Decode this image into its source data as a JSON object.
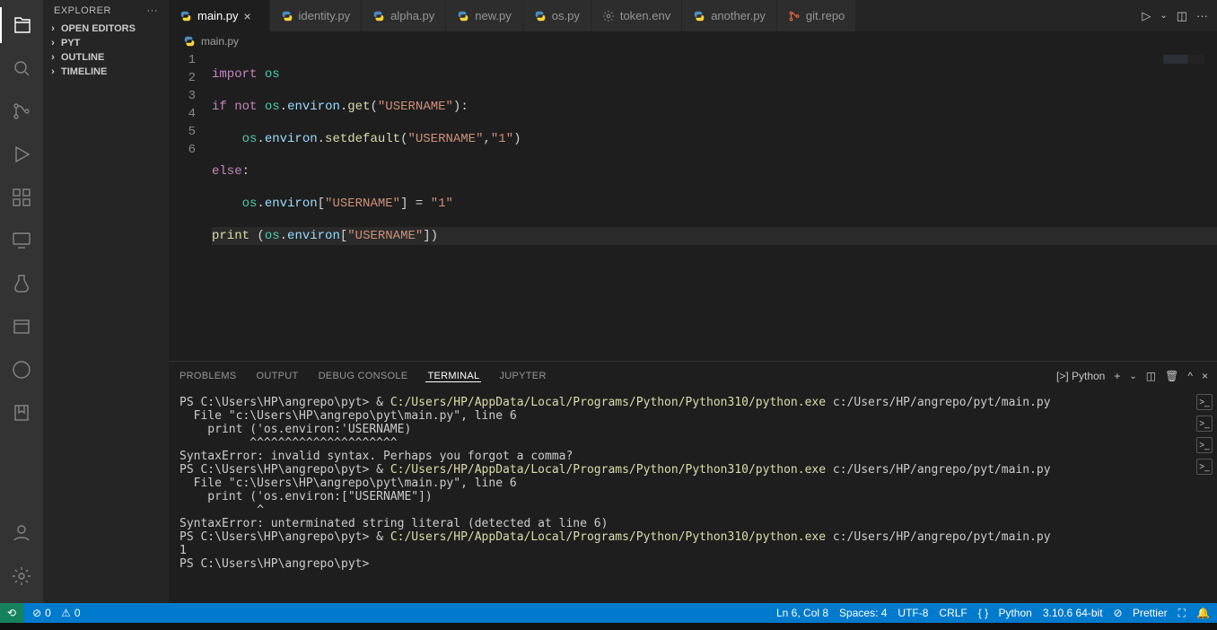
{
  "sidebar": {
    "title": "EXPLORER",
    "sections": [
      "OPEN EDITORS",
      "PYT",
      "OUTLINE",
      "TIMELINE"
    ]
  },
  "tabs": [
    {
      "label": "main.py",
      "icon": "python",
      "active": true
    },
    {
      "label": "identity.py",
      "icon": "python"
    },
    {
      "label": "alpha.py",
      "icon": "python"
    },
    {
      "label": "new.py",
      "icon": "python"
    },
    {
      "label": "os.py",
      "icon": "python"
    },
    {
      "label": "token.env",
      "icon": "gear"
    },
    {
      "label": "another.py",
      "icon": "python"
    },
    {
      "label": "git.repo",
      "icon": "git"
    }
  ],
  "breadcrumb": {
    "file": "main.py"
  },
  "editor": {
    "line_numbers": [
      "1",
      "2",
      "3",
      "4",
      "5",
      "6"
    ]
  },
  "panel_tabs": [
    "PROBLEMS",
    "OUTPUT",
    "DEBUG CONSOLE",
    "TERMINAL",
    "JUPYTER"
  ],
  "panel_active": "TERMINAL",
  "terminal_kind": "Python",
  "terminal": {
    "prompt": "PS C:\\Users\\HP\\angrepo\\pyt> ",
    "amp": "& ",
    "exe": "C:/Users/HP/AppData/Local/Programs/Python/Python310/python.exe",
    "arg": " c:/Users/HP/angrepo/pyt/main.py",
    "file_line": "  File \"c:\\Users\\HP\\angrepo\\pyt\\main.py\", line 6",
    "err1_code": "    print ('os.environ:'USERNAME)",
    "err1_caret": "          ^^^^^^^^^^^^^^^^^^^^^",
    "err1_msg": "SyntaxError: invalid syntax. Perhaps you forgot a comma?",
    "err2_code": "    print ('os.environ:[\"USERNAME\"])",
    "err2_caret": "           ^",
    "err2_msg": "SyntaxError: unterminated string literal (detected at line 6)",
    "result": "1"
  },
  "statusbar": {
    "errors": "0",
    "warnings": "0",
    "ln_col": "Ln 6, Col 8",
    "spaces": "Spaces: 4",
    "encoding": "UTF-8",
    "eol": "CRLF",
    "lang": "Python",
    "interp": "3.10.6 64-bit",
    "prettier": "Prettier"
  }
}
